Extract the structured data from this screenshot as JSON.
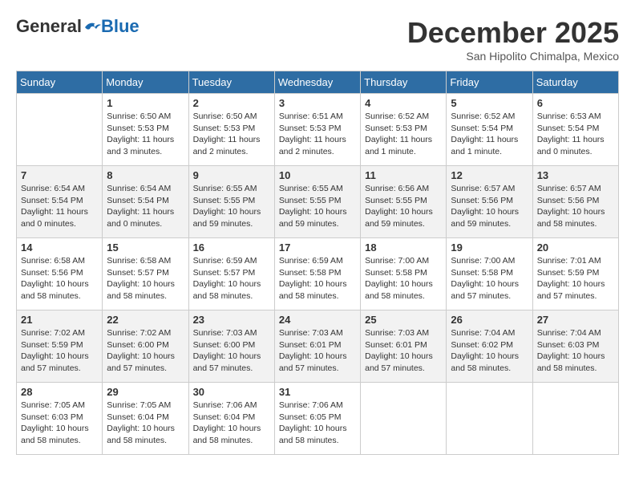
{
  "logo": {
    "general": "General",
    "blue": "Blue"
  },
  "title": {
    "month_year": "December 2025",
    "location": "San Hipolito Chimalpa, Mexico"
  },
  "days_of_week": [
    "Sunday",
    "Monday",
    "Tuesday",
    "Wednesday",
    "Thursday",
    "Friday",
    "Saturday"
  ],
  "weeks": [
    [
      {
        "day": "",
        "info": ""
      },
      {
        "day": "1",
        "info": "Sunrise: 6:50 AM\nSunset: 5:53 PM\nDaylight: 11 hours\nand 3 minutes."
      },
      {
        "day": "2",
        "info": "Sunrise: 6:50 AM\nSunset: 5:53 PM\nDaylight: 11 hours\nand 2 minutes."
      },
      {
        "day": "3",
        "info": "Sunrise: 6:51 AM\nSunset: 5:53 PM\nDaylight: 11 hours\nand 2 minutes."
      },
      {
        "day": "4",
        "info": "Sunrise: 6:52 AM\nSunset: 5:53 PM\nDaylight: 11 hours\nand 1 minute."
      },
      {
        "day": "5",
        "info": "Sunrise: 6:52 AM\nSunset: 5:54 PM\nDaylight: 11 hours\nand 1 minute."
      },
      {
        "day": "6",
        "info": "Sunrise: 6:53 AM\nSunset: 5:54 PM\nDaylight: 11 hours\nand 0 minutes."
      }
    ],
    [
      {
        "day": "7",
        "info": "Sunrise: 6:54 AM\nSunset: 5:54 PM\nDaylight: 11 hours\nand 0 minutes."
      },
      {
        "day": "8",
        "info": "Sunrise: 6:54 AM\nSunset: 5:54 PM\nDaylight: 11 hours\nand 0 minutes."
      },
      {
        "day": "9",
        "info": "Sunrise: 6:55 AM\nSunset: 5:55 PM\nDaylight: 10 hours\nand 59 minutes."
      },
      {
        "day": "10",
        "info": "Sunrise: 6:55 AM\nSunset: 5:55 PM\nDaylight: 10 hours\nand 59 minutes."
      },
      {
        "day": "11",
        "info": "Sunrise: 6:56 AM\nSunset: 5:55 PM\nDaylight: 10 hours\nand 59 minutes."
      },
      {
        "day": "12",
        "info": "Sunrise: 6:57 AM\nSunset: 5:56 PM\nDaylight: 10 hours\nand 59 minutes."
      },
      {
        "day": "13",
        "info": "Sunrise: 6:57 AM\nSunset: 5:56 PM\nDaylight: 10 hours\nand 58 minutes."
      }
    ],
    [
      {
        "day": "14",
        "info": "Sunrise: 6:58 AM\nSunset: 5:56 PM\nDaylight: 10 hours\nand 58 minutes."
      },
      {
        "day": "15",
        "info": "Sunrise: 6:58 AM\nSunset: 5:57 PM\nDaylight: 10 hours\nand 58 minutes."
      },
      {
        "day": "16",
        "info": "Sunrise: 6:59 AM\nSunset: 5:57 PM\nDaylight: 10 hours\nand 58 minutes."
      },
      {
        "day": "17",
        "info": "Sunrise: 6:59 AM\nSunset: 5:58 PM\nDaylight: 10 hours\nand 58 minutes."
      },
      {
        "day": "18",
        "info": "Sunrise: 7:00 AM\nSunset: 5:58 PM\nDaylight: 10 hours\nand 58 minutes."
      },
      {
        "day": "19",
        "info": "Sunrise: 7:00 AM\nSunset: 5:58 PM\nDaylight: 10 hours\nand 57 minutes."
      },
      {
        "day": "20",
        "info": "Sunrise: 7:01 AM\nSunset: 5:59 PM\nDaylight: 10 hours\nand 57 minutes."
      }
    ],
    [
      {
        "day": "21",
        "info": "Sunrise: 7:02 AM\nSunset: 5:59 PM\nDaylight: 10 hours\nand 57 minutes."
      },
      {
        "day": "22",
        "info": "Sunrise: 7:02 AM\nSunset: 6:00 PM\nDaylight: 10 hours\nand 57 minutes."
      },
      {
        "day": "23",
        "info": "Sunrise: 7:03 AM\nSunset: 6:00 PM\nDaylight: 10 hours\nand 57 minutes."
      },
      {
        "day": "24",
        "info": "Sunrise: 7:03 AM\nSunset: 6:01 PM\nDaylight: 10 hours\nand 57 minutes."
      },
      {
        "day": "25",
        "info": "Sunrise: 7:03 AM\nSunset: 6:01 PM\nDaylight: 10 hours\nand 57 minutes."
      },
      {
        "day": "26",
        "info": "Sunrise: 7:04 AM\nSunset: 6:02 PM\nDaylight: 10 hours\nand 58 minutes."
      },
      {
        "day": "27",
        "info": "Sunrise: 7:04 AM\nSunset: 6:03 PM\nDaylight: 10 hours\nand 58 minutes."
      }
    ],
    [
      {
        "day": "28",
        "info": "Sunrise: 7:05 AM\nSunset: 6:03 PM\nDaylight: 10 hours\nand 58 minutes."
      },
      {
        "day": "29",
        "info": "Sunrise: 7:05 AM\nSunset: 6:04 PM\nDaylight: 10 hours\nand 58 minutes."
      },
      {
        "day": "30",
        "info": "Sunrise: 7:06 AM\nSunset: 6:04 PM\nDaylight: 10 hours\nand 58 minutes."
      },
      {
        "day": "31",
        "info": "Sunrise: 7:06 AM\nSunset: 6:05 PM\nDaylight: 10 hours\nand 58 minutes."
      },
      {
        "day": "",
        "info": ""
      },
      {
        "day": "",
        "info": ""
      },
      {
        "day": "",
        "info": ""
      }
    ]
  ]
}
